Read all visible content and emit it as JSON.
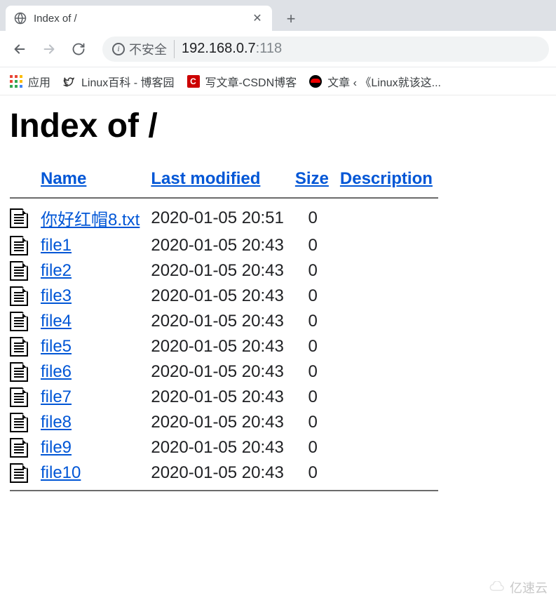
{
  "browser": {
    "tab_title": "Index of /",
    "not_secure_label": "不安全",
    "url_host": "192.168.0.7",
    "url_port": ":118"
  },
  "bookmarks": {
    "apps_label": "应用",
    "items": [
      {
        "label": "Linux百科 - 博客园"
      },
      {
        "label": "写文章-CSDN博客"
      },
      {
        "label": "文章 ‹ 《Linux就该这..."
      }
    ]
  },
  "page": {
    "heading": "Index of /",
    "columns": {
      "name": "Name",
      "last_modified": "Last modified",
      "size": "Size",
      "description": "Description"
    },
    "files": [
      {
        "name": "你好红帽8.txt",
        "modified": "2020-01-05 20:51",
        "size": "0"
      },
      {
        "name": "file1",
        "modified": "2020-01-05 20:43",
        "size": "0"
      },
      {
        "name": "file2",
        "modified": "2020-01-05 20:43",
        "size": "0"
      },
      {
        "name": "file3",
        "modified": "2020-01-05 20:43",
        "size": "0"
      },
      {
        "name": "file4",
        "modified": "2020-01-05 20:43",
        "size": "0"
      },
      {
        "name": "file5",
        "modified": "2020-01-05 20:43",
        "size": "0"
      },
      {
        "name": "file6",
        "modified": "2020-01-05 20:43",
        "size": "0"
      },
      {
        "name": "file7",
        "modified": "2020-01-05 20:43",
        "size": "0"
      },
      {
        "name": "file8",
        "modified": "2020-01-05 20:43",
        "size": "0"
      },
      {
        "name": "file9",
        "modified": "2020-01-05 20:43",
        "size": "0"
      },
      {
        "name": "file10",
        "modified": "2020-01-05 20:43",
        "size": "0"
      }
    ]
  },
  "watermark": "亿速云"
}
